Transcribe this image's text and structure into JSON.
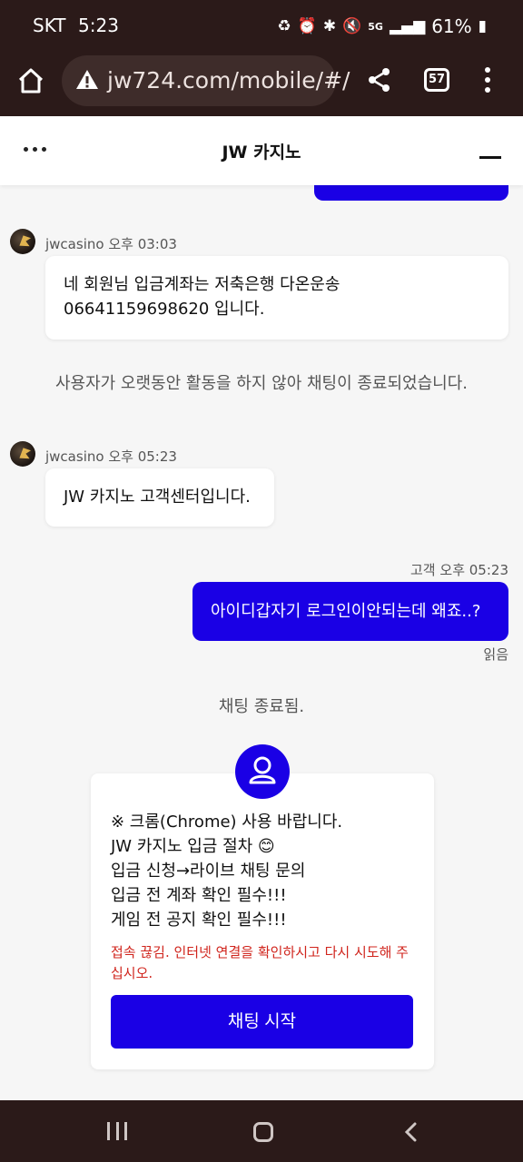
{
  "status_bar": {
    "carrier": "SKT",
    "time": "5:23",
    "network": "5G",
    "battery": "61%"
  },
  "browser": {
    "url": "jw724.com/mobile/#/",
    "tab_count": "57"
  },
  "chat": {
    "title": "JW 카지노",
    "messages": [
      {
        "sender": "jwcasino",
        "time": "오후 03:03",
        "lines": [
          "네 회원님 입금계좌는 저축은행 다온운송",
          "06641159698620 입니다."
        ]
      },
      {
        "system": "사용자가 오랫동안 활동을 하지 않아 채팅이 종료되었습니다."
      },
      {
        "sender": "jwcasino",
        "time": "오후 05:23",
        "lines": [
          "JW 카지노 고객센터입니다."
        ]
      },
      {
        "sender": "고객",
        "time": "오후 05:23",
        "text": "아이디갑자기 로그인이안되는데 왜죠..?",
        "read_label": "읽음"
      }
    ],
    "ended_label": "채팅 종료됨."
  },
  "card": {
    "lines": [
      "※ 크롬(Chrome) 사용 바랍니다.",
      "JW 카지노 입금 절차 😊",
      "입금 신청→라이브 채팅 문의",
      "입금 전 계좌 확인 필수!!!",
      "게임 전 공지 확인 필수!!!"
    ],
    "error": "접속 끊김. 인터넷 연결을 확인하시고 다시 시도해 주십시오.",
    "start_button": "채팅 시작"
  },
  "colors": {
    "accent": "#1a00e5",
    "error": "#d0241c",
    "system_bar": "#2b1a19"
  }
}
